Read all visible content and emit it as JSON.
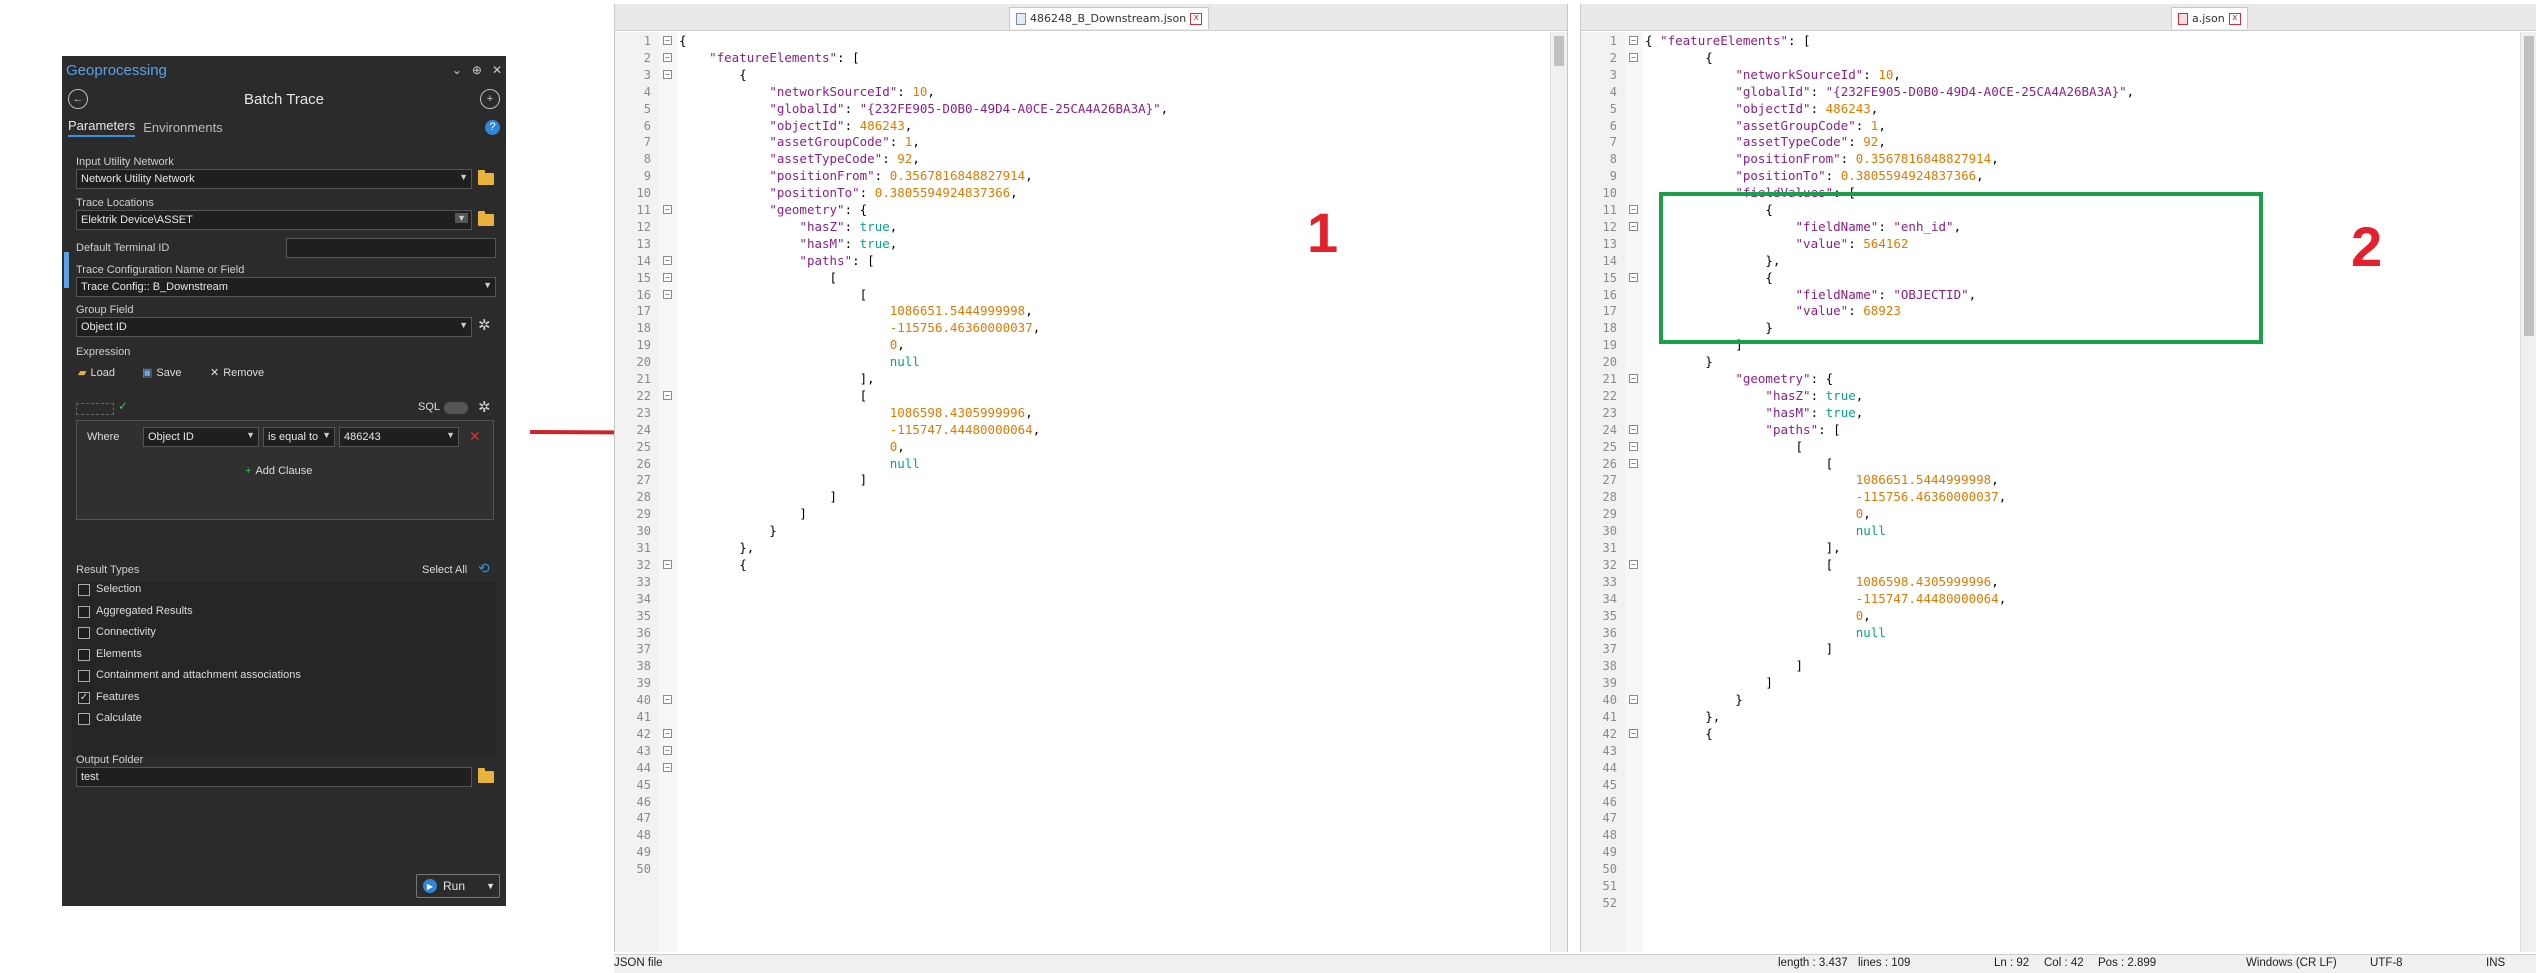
{
  "geoprocessing": {
    "app_title": "Geoprocessing",
    "window_buttons": [
      "⌄",
      "⊕",
      "✕"
    ],
    "tool_title": "Batch Trace",
    "tabs": {
      "parameters": "Parameters",
      "environments": "Environments"
    },
    "help": "?",
    "input_utility_network": {
      "label": "Input Utility Network",
      "value": "Network Utility Network"
    },
    "trace_locations": {
      "label": "Trace Locations",
      "value": "Elektrik Device\\ASSET"
    },
    "default_terminal_id": {
      "label": "Default Terminal ID",
      "value": ""
    },
    "trace_config": {
      "label": "Trace Configuration Name or Field",
      "value": "Trace Config:: B_Downstream"
    },
    "group_field": {
      "label": "Group Field",
      "value": "Object ID"
    },
    "expression": {
      "label": "Expression",
      "load": "Load",
      "save": "Save",
      "remove": "Remove",
      "sql": "SQL"
    },
    "clause": {
      "where": "Where",
      "field": "Object ID",
      "operator": "is equal to",
      "value": "486243",
      "add_clause": "Add Clause"
    },
    "result_types": {
      "label": "Result Types",
      "select_all": "Select All",
      "items": [
        {
          "label": "Selection",
          "checked": false
        },
        {
          "label": "Aggregated Results",
          "checked": false
        },
        {
          "label": "Connectivity",
          "checked": false
        },
        {
          "label": "Elements",
          "checked": false
        },
        {
          "label": "Containment and attachment associations",
          "checked": false
        },
        {
          "label": "Features",
          "checked": true
        },
        {
          "label": "Calculate",
          "checked": false
        }
      ]
    },
    "output_folder": {
      "label": "Output Folder",
      "value": "test"
    },
    "run": "Run"
  },
  "editor1": {
    "tab": "486248_B_Downstream.json",
    "marker": "1",
    "lines": [
      [
        [
          "p",
          "{"
        ]
      ],
      [
        [
          "p",
          "    "
        ],
        [
          "k",
          "\"featureElements\""
        ],
        [
          "p",
          ": ["
        ]
      ],
      [
        [
          "p",
          "        {"
        ]
      ],
      [
        [
          "p",
          "            "
        ],
        [
          "k",
          "\"networkSourceId\""
        ],
        [
          "p",
          ": "
        ],
        [
          "n",
          "10"
        ],
        [
          "p",
          ","
        ]
      ],
      [
        [
          "p",
          "            "
        ],
        [
          "k",
          "\"globalId\""
        ],
        [
          "p",
          ": "
        ],
        [
          "s",
          "\"{232FE905-D0B0-49D4-A0CE-25CA4A26BA3A}\""
        ],
        [
          "p",
          ","
        ]
      ],
      [
        [
          "p",
          "            "
        ],
        [
          "k",
          "\"objectId\""
        ],
        [
          "p",
          ": "
        ],
        [
          "n",
          "486243"
        ],
        [
          "p",
          ","
        ]
      ],
      [
        [
          "p",
          "            "
        ],
        [
          "k",
          "\"assetGroupCode\""
        ],
        [
          "p",
          ": "
        ],
        [
          "n",
          "1"
        ],
        [
          "p",
          ","
        ]
      ],
      [
        [
          "p",
          "            "
        ],
        [
          "k",
          "\"assetTypeCode\""
        ],
        [
          "p",
          ": "
        ],
        [
          "n",
          "92"
        ],
        [
          "p",
          ","
        ]
      ],
      [
        [
          "p",
          "            "
        ],
        [
          "k",
          "\"positionFrom\""
        ],
        [
          "p",
          ": "
        ],
        [
          "n",
          "0.3567816848827914"
        ],
        [
          "p",
          ","
        ]
      ],
      [
        [
          "p",
          "            "
        ],
        [
          "k",
          "\"positionTo\""
        ],
        [
          "p",
          ": "
        ],
        [
          "n",
          "0.3805594924837366"
        ],
        [
          "p",
          ","
        ]
      ],
      [
        [
          "p",
          "            "
        ],
        [
          "k",
          "\"geometry\""
        ],
        [
          "p",
          ": {"
        ]
      ],
      [
        [
          "p",
          "                "
        ],
        [
          "k",
          "\"hasZ\""
        ],
        [
          "p",
          ": "
        ],
        [
          "b",
          "true"
        ],
        [
          "p",
          ","
        ]
      ],
      [
        [
          "p",
          "                "
        ],
        [
          "k",
          "\"hasM\""
        ],
        [
          "p",
          ": "
        ],
        [
          "b",
          "true"
        ],
        [
          "p",
          ","
        ]
      ],
      [
        [
          "p",
          "                "
        ],
        [
          "k",
          "\"paths\""
        ],
        [
          "p",
          ": ["
        ]
      ],
      [
        [
          "p",
          "                    ["
        ]
      ],
      [
        [
          "p",
          "                        ["
        ]
      ],
      [
        [
          "p",
          "                            "
        ],
        [
          "n",
          "1086651.5444999998"
        ],
        [
          "p",
          ","
        ]
      ],
      [
        [
          "p",
          "                            "
        ],
        [
          "n",
          "-115756.46360000037"
        ],
        [
          "p",
          ","
        ]
      ],
      [
        [
          "p",
          "                            "
        ],
        [
          "n",
          "0"
        ],
        [
          "p",
          ","
        ]
      ],
      [
        [
          "p",
          "                            "
        ],
        [
          "b",
          "null"
        ]
      ],
      [
        [
          "p",
          "                        ],"
        ]
      ],
      [
        [
          "p",
          "                        ["
        ]
      ],
      [
        [
          "p",
          "                            "
        ],
        [
          "n",
          "1086598.4305999996"
        ],
        [
          "p",
          ","
        ]
      ],
      [
        [
          "p",
          "                            "
        ],
        [
          "n",
          "-115747.44480000064"
        ],
        [
          "p",
          ","
        ]
      ],
      [
        [
          "p",
          "                            "
        ],
        [
          "n",
          "0"
        ],
        [
          "p",
          ","
        ]
      ],
      [
        [
          "p",
          "                            "
        ],
        [
          "b",
          "null"
        ]
      ],
      [
        [
          "p",
          "                        ]"
        ]
      ],
      [
        [
          "p",
          "                    ]"
        ]
      ],
      [
        [
          "p",
          "                ]"
        ]
      ],
      [
        [
          "p",
          "            }"
        ]
      ],
      [
        [
          "p",
          "        },"
        ]
      ],
      [
        [
          "p",
          "        {"
        ]
      ],
      [],
      [],
      [],
      [],
      [],
      [],
      [],
      [],
      [],
      [],
      [],
      [],
      [],
      [],
      [],
      [],
      [],
      []
    ],
    "folds": [
      1,
      2,
      3,
      11,
      14,
      15,
      16,
      22,
      32,
      40,
      42,
      43,
      44,
      51
    ]
  },
  "editor2": {
    "tab": "a.json",
    "marker": "2",
    "lines": [
      [
        [
          "p",
          "{ "
        ],
        [
          "k",
          "\"featureElements\""
        ],
        [
          "p",
          ": ["
        ]
      ],
      [
        [
          "p",
          "        {"
        ]
      ],
      [
        [
          "p",
          "            "
        ],
        [
          "k",
          "\"networkSourceId\""
        ],
        [
          "p",
          ": "
        ],
        [
          "n",
          "10"
        ],
        [
          "p",
          ","
        ]
      ],
      [
        [
          "p",
          "            "
        ],
        [
          "k",
          "\"globalId\""
        ],
        [
          "p",
          ": "
        ],
        [
          "s",
          "\"{232FE905-D0B0-49D4-A0CE-25CA4A26BA3A}\""
        ],
        [
          "p",
          ","
        ]
      ],
      [
        [
          "p",
          "            "
        ],
        [
          "k",
          "\"objectId\""
        ],
        [
          "p",
          ": "
        ],
        [
          "n",
          "486243"
        ],
        [
          "p",
          ","
        ]
      ],
      [
        [
          "p",
          "            "
        ],
        [
          "k",
          "\"assetGroupCode\""
        ],
        [
          "p",
          ": "
        ],
        [
          "n",
          "1"
        ],
        [
          "p",
          ","
        ]
      ],
      [
        [
          "p",
          "            "
        ],
        [
          "k",
          "\"assetTypeCode\""
        ],
        [
          "p",
          ": "
        ],
        [
          "n",
          "92"
        ],
        [
          "p",
          ","
        ]
      ],
      [
        [
          "p",
          "            "
        ],
        [
          "k",
          "\"positionFrom\""
        ],
        [
          "p",
          ": "
        ],
        [
          "n",
          "0.3567816848827914"
        ],
        [
          "p",
          ","
        ]
      ],
      [
        [
          "p",
          "            "
        ],
        [
          "k",
          "\"positionTo\""
        ],
        [
          "p",
          ": "
        ],
        [
          "n",
          "0.3805594924837366"
        ],
        [
          "p",
          ","
        ]
      ],
      [
        [
          "p",
          "            "
        ],
        [
          "k",
          "\"fieldValues\""
        ],
        [
          "p",
          ": ["
        ]
      ],
      [
        [
          "p",
          "                {"
        ]
      ],
      [
        [
          "p",
          "                    "
        ],
        [
          "k",
          "\"fieldName\""
        ],
        [
          "p",
          ": "
        ],
        [
          "s",
          "\"enh_id\""
        ],
        [
          "p",
          ","
        ]
      ],
      [
        [
          "p",
          "                    "
        ],
        [
          "k",
          "\"value\""
        ],
        [
          "p",
          ": "
        ],
        [
          "n",
          "564162"
        ]
      ],
      [
        [
          "p",
          "                },"
        ]
      ],
      [
        [
          "p",
          "                {"
        ]
      ],
      [
        [
          "p",
          "                    "
        ],
        [
          "k",
          "\"fieldName\""
        ],
        [
          "p",
          ": "
        ],
        [
          "s",
          "\"OBJECTID\""
        ],
        [
          "p",
          ","
        ]
      ],
      [
        [
          "p",
          "                    "
        ],
        [
          "k",
          "\"value\""
        ],
        [
          "p",
          ": "
        ],
        [
          "n",
          "68923"
        ]
      ],
      [
        [
          "p",
          "                }"
        ]
      ],
      [
        [
          "p",
          "            ]"
        ]
      ],
      [
        [
          "p",
          "        }"
        ]
      ],
      [
        [
          "p",
          "            "
        ],
        [
          "k",
          "\"geometry\""
        ],
        [
          "p",
          ": {"
        ]
      ],
      [
        [
          "p",
          "                "
        ],
        [
          "k",
          "\"hasZ\""
        ],
        [
          "p",
          ": "
        ],
        [
          "b",
          "true"
        ],
        [
          "p",
          ","
        ]
      ],
      [
        [
          "p",
          "                "
        ],
        [
          "k",
          "\"hasM\""
        ],
        [
          "p",
          ": "
        ],
        [
          "b",
          "true"
        ],
        [
          "p",
          ","
        ]
      ],
      [
        [
          "p",
          "                "
        ],
        [
          "k",
          "\"paths\""
        ],
        [
          "p",
          ": ["
        ]
      ],
      [
        [
          "p",
          "                    ["
        ]
      ],
      [
        [
          "p",
          "                        ["
        ]
      ],
      [
        [
          "p",
          "                            "
        ],
        [
          "n",
          "1086651.5444999998"
        ],
        [
          "p",
          ","
        ]
      ],
      [
        [
          "p",
          "                            "
        ],
        [
          "n",
          "-115756.46360000037"
        ],
        [
          "p",
          ","
        ]
      ],
      [
        [
          "p",
          "                            "
        ],
        [
          "n",
          "0"
        ],
        [
          "p",
          ","
        ]
      ],
      [
        [
          "p",
          "                            "
        ],
        [
          "b",
          "null"
        ]
      ],
      [
        [
          "p",
          "                        ],"
        ]
      ],
      [
        [
          "p",
          "                        ["
        ]
      ],
      [
        [
          "p",
          "                            "
        ],
        [
          "n",
          "1086598.4305999996"
        ],
        [
          "p",
          ","
        ]
      ],
      [
        [
          "p",
          "                            "
        ],
        [
          "n",
          "-115747.44480000064"
        ],
        [
          "p",
          ","
        ]
      ],
      [
        [
          "p",
          "                            "
        ],
        [
          "n",
          "0"
        ],
        [
          "p",
          ","
        ]
      ],
      [
        [
          "p",
          "                            "
        ],
        [
          "b",
          "null"
        ]
      ],
      [
        [
          "p",
          "                        ]"
        ]
      ],
      [
        [
          "p",
          "                    ]"
        ]
      ],
      [
        [
          "p",
          "                ]"
        ]
      ],
      [
        [
          "p",
          "            }"
        ]
      ],
      [
        [
          "p",
          "        },"
        ]
      ],
      [
        [
          "p",
          "        {"
        ]
      ],
      [],
      [],
      [],
      [],
      [],
      [],
      [],
      [],
      [],
      []
    ],
    "folds": [
      1,
      2,
      11,
      12,
      15,
      21,
      24,
      25,
      26,
      32,
      40,
      42
    ]
  },
  "status": {
    "file_type": "JSON file",
    "length": "length : 3.437",
    "lines": "lines : 109",
    "ln": "Ln : 92",
    "col": "Col : 42",
    "pos": "Pos : 2.899",
    "eol": "Windows (CR LF)",
    "encoding": "UTF-8",
    "mode": "INS"
  },
  "colors": {
    "arrow": "#d1222c",
    "highlight": "#1aa04a",
    "marker": "#e3202c",
    "json_key": "#8a1f8a",
    "json_number": "#e07a00",
    "json_bool": "#0aa28a"
  }
}
